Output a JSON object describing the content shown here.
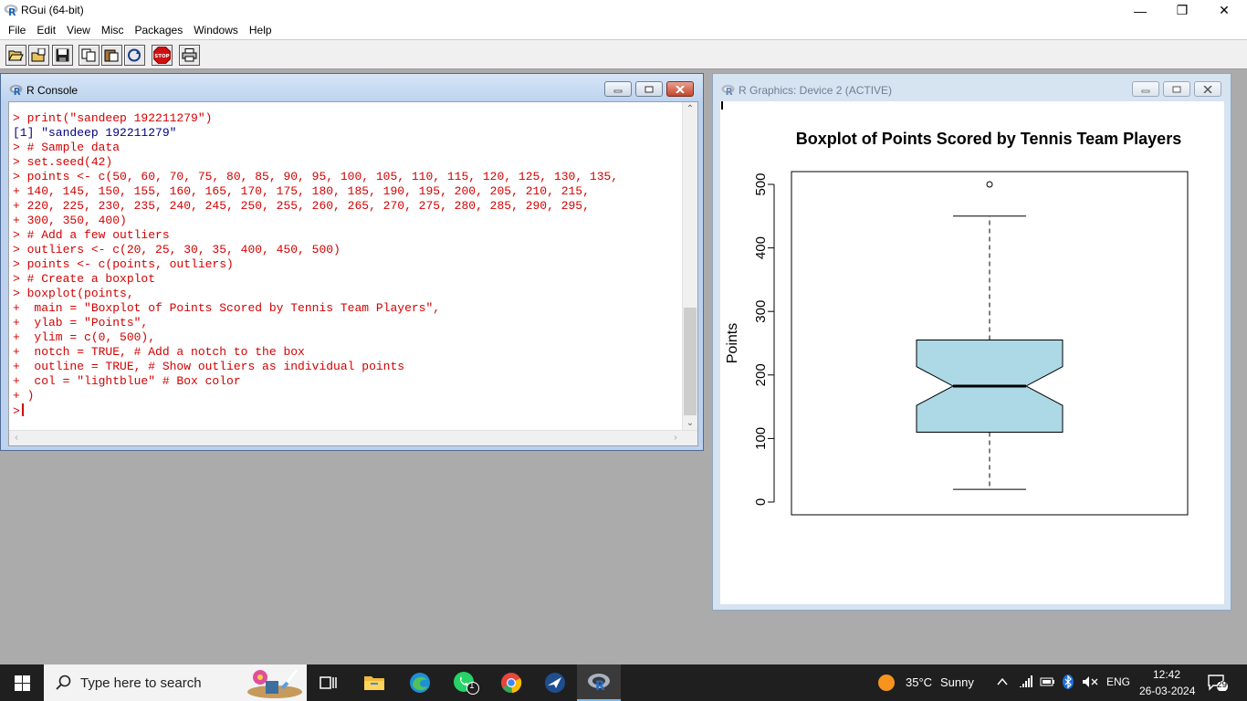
{
  "app": {
    "title": "RGui (64-bit)",
    "minimize": "—",
    "maximize": "❐",
    "close": "✕"
  },
  "menu": [
    "File",
    "Edit",
    "View",
    "Misc",
    "Packages",
    "Windows",
    "Help"
  ],
  "toolbar": {
    "icons": [
      "open-script-icon",
      "load-workspace-icon",
      "save-icon",
      "copy-icon",
      "paste-icon",
      "copy-paste-icon",
      "stop-icon",
      "print-icon"
    ],
    "stop_label": "STOP"
  },
  "console": {
    "title": "R Console",
    "lines": [
      {
        "kind": "in",
        "text": "> print(\"sandeep 192211279\")"
      },
      {
        "kind": "out",
        "text": "[1] \"sandeep 192211279\""
      },
      {
        "kind": "in",
        "text": "> # Sample data"
      },
      {
        "kind": "in",
        "text": "> set.seed(42)"
      },
      {
        "kind": "in",
        "text": "> points <- c(50, 60, 70, 75, 80, 85, 90, 95, 100, 105, 110, 115, 120, 125, 130, 135,"
      },
      {
        "kind": "in",
        "text": "+ 140, 145, 150, 155, 160, 165, 170, 175, 180, 185, 190, 195, 200, 205, 210, 215,"
      },
      {
        "kind": "in",
        "text": "+ 220, 225, 230, 235, 240, 245, 250, 255, 260, 265, 270, 275, 280, 285, 290, 295,"
      },
      {
        "kind": "in",
        "text": "+ 300, 350, 400)"
      },
      {
        "kind": "in",
        "text": "> # Add a few outliers"
      },
      {
        "kind": "in",
        "text": "> outliers <- c(20, 25, 30, 35, 400, 450, 500)"
      },
      {
        "kind": "in",
        "text": "> points <- c(points, outliers)"
      },
      {
        "kind": "in",
        "text": "> # Create a boxplot"
      },
      {
        "kind": "in",
        "text": "> boxplot(points,"
      },
      {
        "kind": "in",
        "text": "+  main = \"Boxplot of Points Scored by Tennis Team Players\","
      },
      {
        "kind": "in",
        "text": "+  ylab = \"Points\","
      },
      {
        "kind": "in",
        "text": "+  ylim = c(0, 500),"
      },
      {
        "kind": "in",
        "text": "+  notch = TRUE, # Add a notch to the box"
      },
      {
        "kind": "in",
        "text": "+  outline = TRUE, # Show outliers as individual points"
      },
      {
        "kind": "in",
        "text": "+  col = \"lightblue\" # Box color"
      },
      {
        "kind": "in",
        "text": "+ )"
      }
    ],
    "prompt": ">"
  },
  "graphics": {
    "title": "R Graphics: Device 2 (ACTIVE)"
  },
  "chart_data": {
    "type": "boxplot",
    "title": "Boxplot of Points Scored by Tennis Team Players",
    "ylabel": "Points",
    "xlabel": "",
    "ylim": [
      0,
      500
    ],
    "yticks": [
      0,
      100,
      200,
      300,
      400,
      500
    ],
    "notch": true,
    "box_color": "#add8e6",
    "stats": {
      "whisker_low": 20,
      "q1": 110,
      "median": 182.5,
      "q3": 255,
      "whisker_high": 450,
      "notch_low": 152,
      "notch_high": 213
    },
    "outliers": [
      500
    ]
  },
  "taskbar": {
    "search_placeholder": "Type here to search",
    "apps": [
      "task-view-icon",
      "file-explorer-icon",
      "edge-icon",
      "whatsapp-icon",
      "chrome-icon",
      "mail-bird-icon",
      "r-gui-icon"
    ],
    "whatsapp_badge": "1",
    "weather_temp": "35°C",
    "weather_text": "Sunny",
    "language": "ENG",
    "time": "12:42",
    "date": "26-03-2024",
    "notifications": "29"
  }
}
